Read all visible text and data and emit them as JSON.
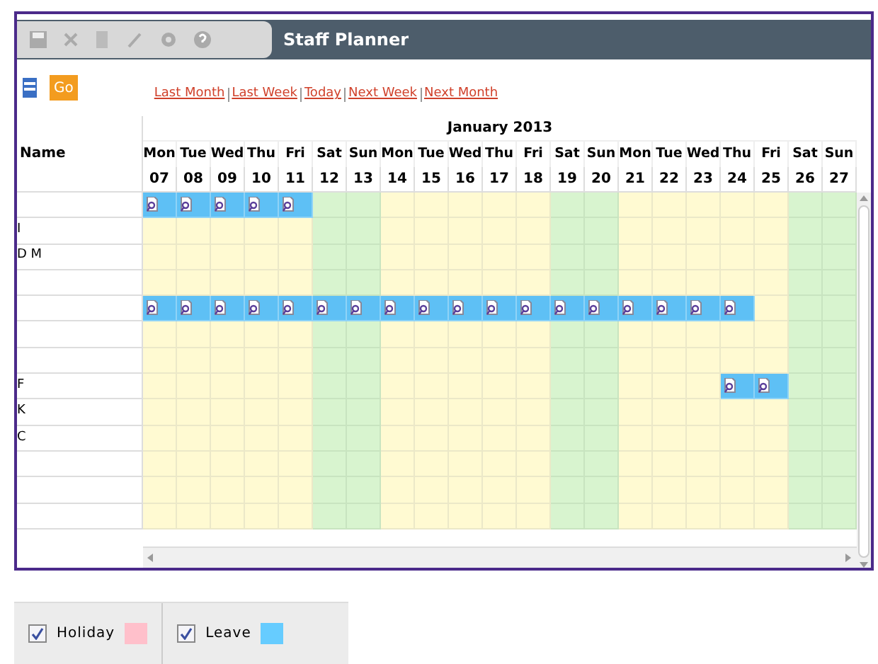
{
  "window": {
    "title": "Staff Planner"
  },
  "nav_links": [
    "Last Month",
    "Last Week",
    "Today",
    "Next Week",
    "Next Month"
  ],
  "go_button": "Go",
  "table": {
    "name_header": "Name",
    "month": "January 2013",
    "days": [
      {
        "day": "Mon",
        "date": "07",
        "weekend": false
      },
      {
        "day": "Tue",
        "date": "08",
        "weekend": false
      },
      {
        "day": "Wed",
        "date": "09",
        "weekend": false
      },
      {
        "day": "Thu",
        "date": "10",
        "weekend": false
      },
      {
        "day": "Fri",
        "date": "11",
        "weekend": false
      },
      {
        "day": "Sat",
        "date": "12",
        "weekend": true
      },
      {
        "day": "Sun",
        "date": "13",
        "weekend": true
      },
      {
        "day": "Mon",
        "date": "14",
        "weekend": false
      },
      {
        "day": "Tue",
        "date": "15",
        "weekend": false
      },
      {
        "day": "Wed",
        "date": "16",
        "weekend": false
      },
      {
        "day": "Thu",
        "date": "17",
        "weekend": false
      },
      {
        "day": "Fri",
        "date": "18",
        "weekend": false
      },
      {
        "day": "Sat",
        "date": "19",
        "weekend": true
      },
      {
        "day": "Sun",
        "date": "20",
        "weekend": true
      },
      {
        "day": "Mon",
        "date": "21",
        "weekend": false
      },
      {
        "day": "Tue",
        "date": "22",
        "weekend": false
      },
      {
        "day": "Wed",
        "date": "23",
        "weekend": false
      },
      {
        "day": "Thu",
        "date": "24",
        "weekend": false
      },
      {
        "day": "Fri",
        "date": "25",
        "weekend": false
      },
      {
        "day": "Sat",
        "date": "26",
        "weekend": true
      },
      {
        "day": "Sun",
        "date": "27",
        "weekend": true
      }
    ],
    "rows": [
      {
        "leave": [
          true,
          true,
          true,
          true,
          true,
          false,
          false,
          false,
          false,
          false,
          false,
          false,
          false,
          false,
          false,
          false,
          false,
          false,
          false,
          false,
          false
        ]
      },
      {
        "name": "I",
        "leave": [
          false,
          false,
          false,
          false,
          false,
          false,
          false,
          false,
          false,
          false,
          false,
          false,
          false,
          false,
          false,
          false,
          false,
          false,
          false,
          false,
          false
        ]
      },
      {
        "name": "D M",
        "leave": [
          false,
          false,
          false,
          false,
          false,
          false,
          false,
          false,
          false,
          false,
          false,
          false,
          false,
          false,
          false,
          false,
          false,
          false,
          false,
          false,
          false
        ]
      },
      {
        "leave": [
          false,
          false,
          false,
          false,
          false,
          false,
          false,
          false,
          false,
          false,
          false,
          false,
          false,
          false,
          false,
          false,
          false,
          false,
          false,
          false,
          false
        ]
      },
      {
        "leave": [
          true,
          true,
          true,
          true,
          true,
          true,
          true,
          true,
          true,
          true,
          true,
          true,
          true,
          true,
          true,
          true,
          true,
          true,
          false,
          false,
          false
        ]
      },
      {
        "leave": [
          false,
          false,
          false,
          false,
          false,
          false,
          false,
          false,
          false,
          false,
          false,
          false,
          false,
          false,
          false,
          false,
          false,
          false,
          false,
          false,
          false
        ]
      },
      {
        "leave": [
          false,
          false,
          false,
          false,
          false,
          false,
          false,
          false,
          false,
          false,
          false,
          false,
          false,
          false,
          false,
          false,
          false,
          false,
          false,
          false,
          false
        ]
      },
      {
        "name": "F",
        "leave": [
          false,
          false,
          false,
          false,
          false,
          false,
          false,
          false,
          false,
          false,
          false,
          false,
          false,
          false,
          false,
          false,
          false,
          true,
          true,
          false,
          false
        ]
      },
      {
        "name": "K",
        "leave": [
          false,
          false,
          false,
          false,
          false,
          false,
          false,
          false,
          false,
          false,
          false,
          false,
          false,
          false,
          false,
          false,
          false,
          false,
          false,
          false,
          false
        ]
      },
      {
        "name": "C",
        "leave": [
          false,
          false,
          false,
          false,
          false,
          false,
          false,
          false,
          false,
          false,
          false,
          false,
          false,
          false,
          false,
          false,
          false,
          false,
          false,
          false,
          false
        ]
      },
      {
        "leave": [
          false,
          false,
          false,
          false,
          false,
          false,
          false,
          false,
          false,
          false,
          false,
          false,
          false,
          false,
          false,
          false,
          false,
          false,
          false,
          false,
          false
        ]
      },
      {
        "leave": [
          false,
          false,
          false,
          false,
          false,
          false,
          false,
          false,
          false,
          false,
          false,
          false,
          false,
          false,
          false,
          false,
          false,
          false,
          false,
          false,
          false
        ]
      },
      {
        "leave": [
          false,
          false,
          false,
          false,
          false,
          false,
          false,
          false,
          false,
          false,
          false,
          false,
          false,
          false,
          false,
          false,
          false,
          false,
          false,
          false,
          false
        ]
      }
    ]
  },
  "legend": [
    {
      "label": "Holiday",
      "checked": true,
      "color": "#ffc0cb"
    },
    {
      "label": "Leave",
      "checked": true,
      "color": "#66ccff"
    }
  ]
}
